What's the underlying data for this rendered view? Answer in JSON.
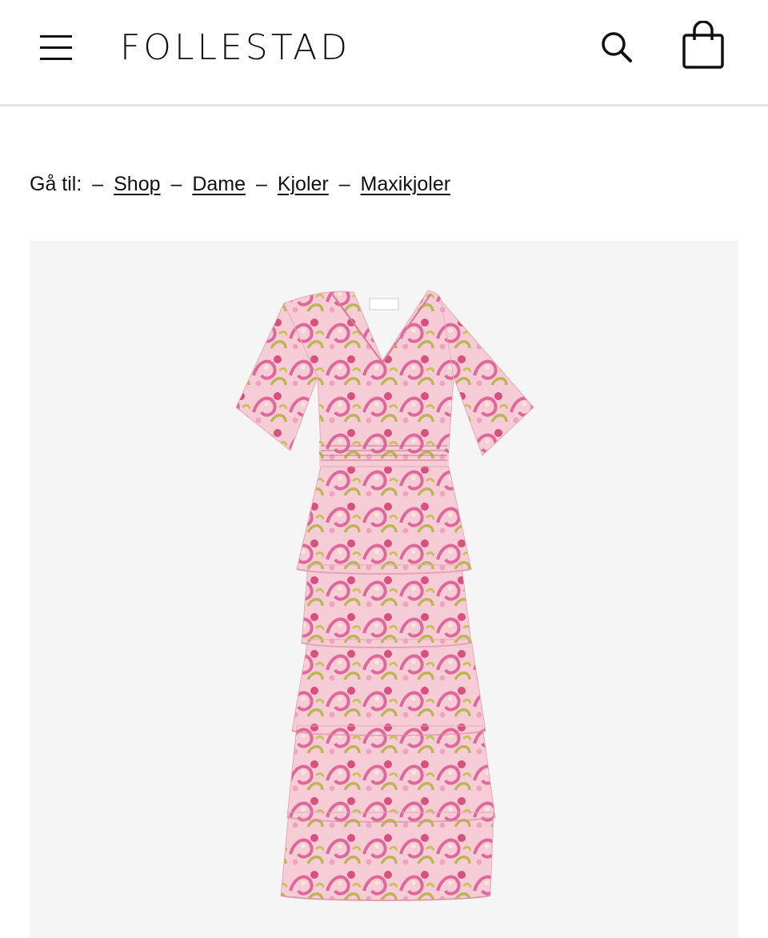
{
  "header": {
    "logo": "FOLLESTAD",
    "menu_icon": "hamburger-menu-icon",
    "search_icon": "search-icon",
    "cart_icon": "shopping-bag-icon"
  },
  "breadcrumb": {
    "prefix": "Gå til:",
    "separator": "–",
    "items": [
      {
        "label": "Shop"
      },
      {
        "label": "Dame"
      },
      {
        "label": "Kjoler"
      },
      {
        "label": "Maxikjoler"
      }
    ]
  },
  "product": {
    "image_background": "#f5f5f5",
    "dress_base_color": "#f3c6cf",
    "pattern_colors": [
      "#e36a9a",
      "#d94f7e",
      "#b9b24f",
      "#f0a3bd",
      "#fbe3d8"
    ]
  }
}
